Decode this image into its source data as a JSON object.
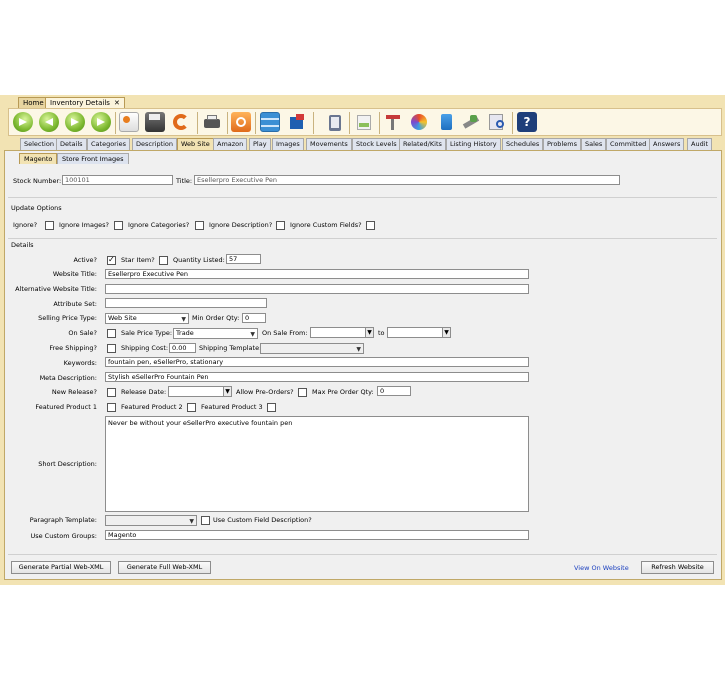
{
  "doc_tabs": [
    {
      "label": "Home"
    },
    {
      "label": "Inventory Details",
      "close": "✕"
    }
  ],
  "main_tabs": [
    "Selection",
    "Details",
    "Categories",
    "Description",
    "Web Site",
    "Amazon",
    "Play",
    "Images",
    "Movements",
    "Stock Levels",
    "Related/Kits",
    "Listing History",
    "Schedules",
    "Problems",
    "Sales",
    "Committed",
    "Answers",
    "Audit"
  ],
  "active_main_tab": "Web Site",
  "sub_tabs": [
    "Magento",
    "Store Front Images"
  ],
  "header": {
    "stock_number_label": "Stock Number:",
    "stock_number_value": "100101",
    "title_label": "Title:",
    "title_value": "Esellerpro Executive Pen"
  },
  "update_options": {
    "section_label": "Update Options",
    "ignore_label": "Ignore?",
    "ignore_images_label": "Ignore Images?",
    "ignore_categories_label": "Ignore Categories?",
    "ignore_description_label": "Ignore Description?",
    "ignore_custom_fields_label": "Ignore Custom Fields?"
  },
  "details": {
    "section_label": "Details",
    "active_label": "Active?",
    "active_checked": true,
    "star_item_label": "Star Item?",
    "quantity_listed_label": "Quantity Listed:",
    "quantity_listed_value": "57",
    "website_title_label": "Website Title:",
    "website_title_value": "Esellerpro Executive Pen",
    "alt_website_title_label": "Alternative Website Title:",
    "alt_website_title_value": "",
    "attribute_set_label": "Attribute Set:",
    "attribute_set_value": "",
    "selling_price_type_label": "Selling Price Type:",
    "selling_price_type_value": "Web Site",
    "min_order_qty_label": "Min Order Qty:",
    "min_order_qty_value": "0",
    "on_sale_label": "On Sale?",
    "sale_price_type_label": "Sale Price Type:",
    "sale_price_type_checked": true,
    "sale_price_type_value": "Trade",
    "on_sale_from_label": "On Sale From:",
    "to_label": "to",
    "free_shipping_label": "Free Shipping?",
    "shipping_cost_label": "Shipping Cost:",
    "shipping_cost_value": "0.00",
    "shipping_template_label": "Shipping Template:",
    "keywords_label": "Keywords:",
    "keywords_value": "fountain pen, eSellerPro, stationary",
    "meta_description_label": "Meta Description:",
    "meta_description_value": "Stylish eSellerPro Fountain Pen",
    "new_release_label": "New Release?",
    "release_date_label": "Release Date:",
    "allow_preorders_label": "Allow Pre-Orders?",
    "max_preorder_qty_label": "Max Pre Order Qty:",
    "max_preorder_qty_value": "0",
    "featured_product_1_label": "Featured Product 1",
    "featured_product_2_label": "Featured Product 2",
    "featured_product_3_label": "Featured Product 3",
    "short_description_label": "Short Description:",
    "short_description_value": "Never be without your eSellerPro executive fountain pen",
    "paragraph_template_label": "Paragraph Template:",
    "use_custom_field_desc_label": "Use Custom Field Description?",
    "use_custom_groups_label": "Use Custom Groups:",
    "use_custom_groups_value": "Magento"
  },
  "footer": {
    "gen_partial_label": "Generate Partial Web-XML",
    "gen_full_label": "Generate Full Web-XML",
    "view_on_website_label": "View On Website",
    "refresh_website_label": "Refresh Website"
  },
  "colors": {
    "app_bg": "#f2e3b3",
    "panel_bg": "#f0f0f0",
    "link": "#1a3fbf"
  },
  "toolbar_icons": [
    "first-icon",
    "previous-icon",
    "next-icon",
    "last-icon",
    "new-icon",
    "save-icon",
    "refresh-icon",
    "print-icon",
    "undo-icon",
    "grid-icon",
    "export-icon",
    "clipboard-icon",
    "document-icon",
    "report-icon",
    "palette-icon",
    "notebook-icon",
    "tools-icon",
    "inspect-icon",
    "help-icon"
  ]
}
